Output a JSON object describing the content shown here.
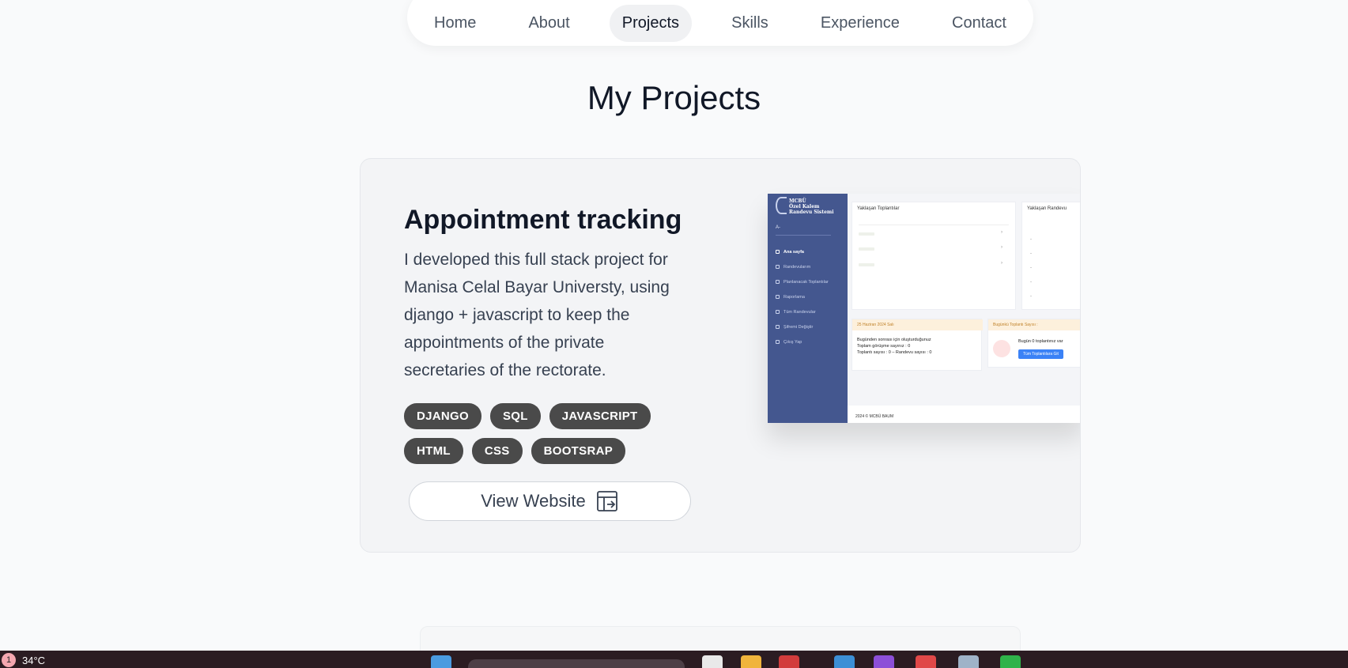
{
  "nav": {
    "items": [
      {
        "label": "Home"
      },
      {
        "label": "About"
      },
      {
        "label": "Projects"
      },
      {
        "label": "Skills"
      },
      {
        "label": "Experience"
      },
      {
        "label": "Contact"
      }
    ],
    "active_index": 2
  },
  "page": {
    "title": "My Projects"
  },
  "project": {
    "title": "Appointment tracking",
    "description": "I developed this full stack project for Manisa Celal Bayar Universty, using django + javascript to keep the appointments of the private secretaries of the rectorate.",
    "tags": [
      "DJANGO",
      "SQL",
      "JAVASCRIPT",
      "HTML",
      "CSS",
      "BOOTSRAP"
    ],
    "view_label": "View Website",
    "screenshot": {
      "logo_lines": [
        "MCBÜ",
        "Özel Kalem",
        "Randevu Sistemi"
      ],
      "lang": "A-",
      "menu": [
        "Ana sayfa",
        "Randevularım",
        "Planlanacak Toplantılar",
        "Raporlama",
        "Tüm Randevular",
        "Şifremi Değiştir",
        "Çıkış Yap"
      ],
      "panel1_title": "Yaklaşan Toplantılar",
      "panel2_title": "Yaklaşan Randevu",
      "date_banner": "25 Haziran 2024 Salı",
      "today_banner": "Bugünkü Toplantı Sayısı :",
      "stats": [
        "Bugünden sonrası için oluşturduğunuz",
        "Toplam görüşme sayınız : 0",
        "Toplantı sayısı : 0 – Randevu sayısı : 0"
      ],
      "today_text": "Bugün 0 toplantınız var",
      "today_button": "Tüm Toplantılara Git",
      "footer": "2024 © MCBÜ BAUM"
    }
  },
  "taskbar": {
    "weather": "34°C",
    "badge": "1"
  },
  "colors": {
    "sidebar": "#44578f",
    "tag_bg": "#4a4a4a",
    "accent": "#3b82f6",
    "taskbar": "#2b1c22"
  }
}
